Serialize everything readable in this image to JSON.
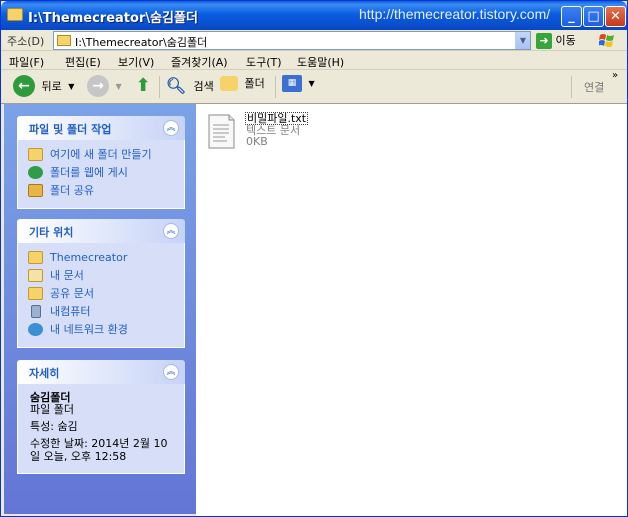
{
  "window": {
    "title": "I:\\Themecreator\\숨김폴더",
    "watermark": "http://themecreator.tistory.com/",
    "minimize": "_",
    "maximize": "□",
    "close": "✕"
  },
  "address": {
    "label": "주소(D)",
    "value": "I:\\Themecreator\\숨김폴더",
    "go_label": "이동"
  },
  "menu": [
    "파일(F)",
    "편집(E)",
    "보기(V)",
    "즐겨찾기(A)",
    "도구(T)",
    "도움말(H)"
  ],
  "toolbar": {
    "back": "뒤로",
    "search": "검색",
    "folders": "폴더",
    "links": "연결",
    "more": "»"
  },
  "panels": {
    "file_tasks": {
      "title": "파일 및 폴더 작업",
      "items": [
        "여기에 새 폴더 만들기",
        "폴더를 웹에 게시",
        "폴더 공유"
      ]
    },
    "other_places": {
      "title": "기타 위치",
      "items": [
        "Themecreator",
        "내 문서",
        "공유 문서",
        "내컴퓨터",
        "내 네트워크 환경"
      ]
    },
    "details": {
      "title": "자세히",
      "name": "숨김폴더",
      "type": "파일 폴더",
      "attributes": "특성: 숨김",
      "modified": "수정한 날짜: 2014년 2월 10일 오늘, 오후 12:58"
    }
  },
  "files": [
    {
      "name": "비밀파일.txt",
      "type": "텍스트 문서",
      "size": "0KB",
      "icon": "text-document-icon"
    }
  ],
  "colors": {
    "titlebar": "#0a5fd8",
    "panel_bg": "#7ba2e7",
    "link": "#215dc6"
  }
}
